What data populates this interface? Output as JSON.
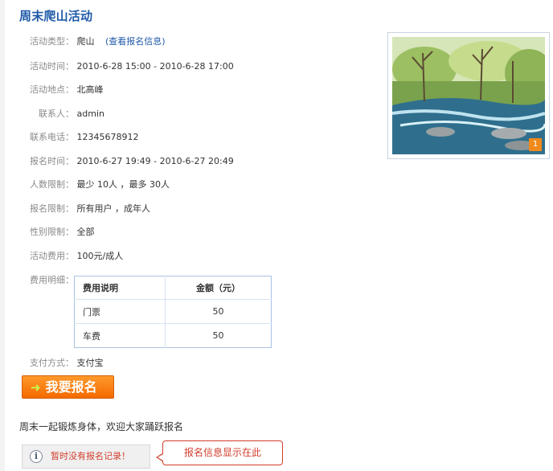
{
  "page": {
    "title": "周末爬山活动"
  },
  "details": {
    "type_label": "活动类型：",
    "type_value": "爬山",
    "view_signup_link": "(查看报名信息)",
    "time_label": "活动时间：",
    "time_value": "2010-6-28 15:00 - 2010-6-28 17:00",
    "place_label": "活动地点：",
    "place_value": "北高峰",
    "contact_label": "联系人：",
    "contact_value": "admin",
    "phone_label": "联系电话：",
    "phone_value": "12345678912",
    "signup_time_label": "报名时间：",
    "signup_time_value": "2010-6-27 19:49 - 2010-6-27 20:49",
    "people_limit_label": "人数限制：",
    "people_limit_value": "最少 10人 ，最多 30人",
    "signup_limit_label": "报名限制：",
    "signup_limit_value": "所有用户 ，成年人",
    "gender_limit_label": "性别限制：",
    "gender_limit_value": "全部",
    "fee_label": "活动费用：",
    "fee_value": "100元/成人",
    "fee_detail_label": "费用明细：",
    "payment_label": "支付方式：",
    "payment_value": "支付宝"
  },
  "fee_table": {
    "header_desc": "费用说明",
    "header_amount": "金额（元）",
    "rows": [
      {
        "desc": "门票",
        "amount": "50"
      },
      {
        "desc": "车费",
        "amount": "50"
      }
    ]
  },
  "photo": {
    "badge": "1"
  },
  "actions": {
    "signup_button": "我要报名"
  },
  "welcome_text": "周末一起锻炼身体，欢迎大家踊跃报名",
  "signup_records": {
    "empty_notice": "暂时没有报名记录！",
    "callout": "报名信息显示在此"
  },
  "colors": {
    "title": "#1f5aa8",
    "button": "#f46a00",
    "alert": "#d23d2c"
  }
}
